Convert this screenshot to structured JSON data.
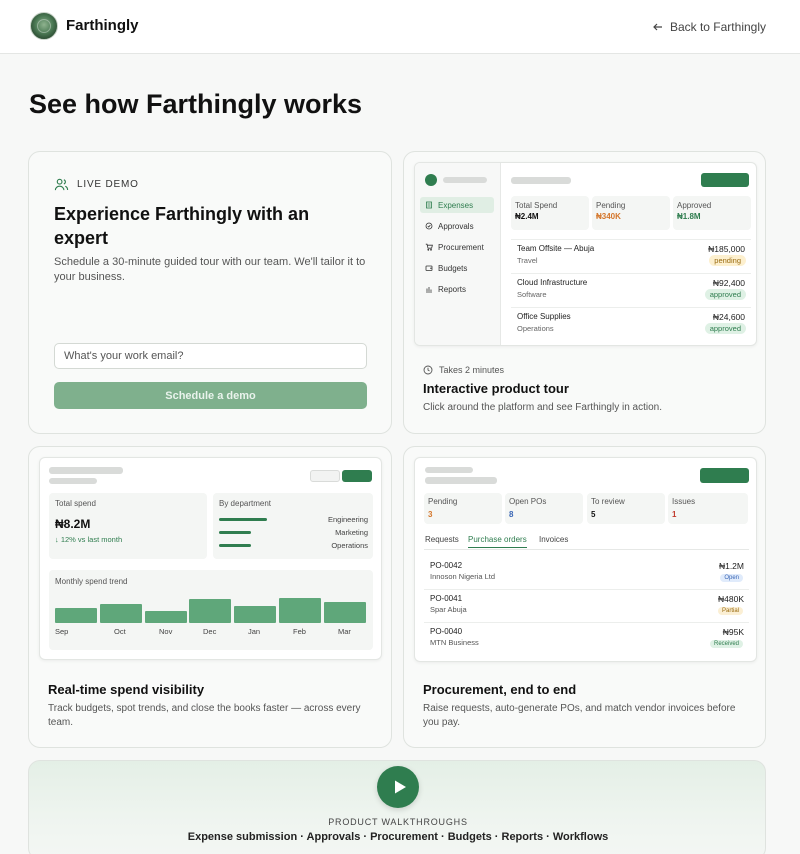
{
  "header": {
    "brand": "Farthingly",
    "back_link": "Back to Farthingly"
  },
  "page": {
    "title": "See how Farthingly works"
  },
  "demo_card": {
    "eyebrow": "LIVE DEMO",
    "title": "Experience Farthingly with an expert",
    "description": "Schedule a 30-minute guided tour with our team. We'll tailor it to your business.",
    "email_placeholder": "What's your work email?",
    "button_label": "Schedule a demo"
  },
  "tour_card": {
    "duration": "Takes 2 minutes",
    "title": "Interactive product tour",
    "description": "Click around the platform and see Farthingly in action.",
    "mock": {
      "nav": [
        "Expenses",
        "Approvals",
        "Procurement",
        "Budgets",
        "Reports"
      ],
      "stats": [
        {
          "label": "Total Spend",
          "value": "₦2.4M",
          "color": "#111111"
        },
        {
          "label": "Pending",
          "value": "₦340K",
          "color": "#d4762b"
        },
        {
          "label": "Approved",
          "value": "₦1.8M",
          "color": "#2f7d4f"
        }
      ],
      "transactions": [
        {
          "name": "Team Offsite — Abuja",
          "category": "Travel",
          "amount": "₦185,000",
          "status": "pending"
        },
        {
          "name": "Cloud Infrastructure",
          "category": "Software",
          "amount": "₦92,400",
          "status": "approved"
        },
        {
          "name": "Office Supplies",
          "category": "Operations",
          "amount": "₦24,600",
          "status": "approved"
        }
      ]
    }
  },
  "spend_card": {
    "title": "Real-time spend visibility",
    "description": "Track budgets, spot trends, and close the books faster — across every team.",
    "mock": {
      "total_label": "Total spend",
      "total_value": "₦8.2M",
      "delta": "↓ 12% vs last month",
      "dept_label": "By department",
      "departments": [
        {
          "name": "Engineering",
          "share": 0.67
        },
        {
          "name": "Marketing",
          "share": 0.45
        },
        {
          "name": "Operations",
          "share": 0.45
        }
      ],
      "trend_label": "Monthly spend trend",
      "trend": [
        {
          "month": "Sep",
          "value": 0.55
        },
        {
          "month": "Oct",
          "value": 0.7
        },
        {
          "month": "Nov",
          "value": 0.45
        },
        {
          "month": "Dec",
          "value": 0.88
        },
        {
          "month": "Jan",
          "value": 0.62
        },
        {
          "month": "Feb",
          "value": 0.92
        },
        {
          "month": "Mar",
          "value": 0.78
        }
      ]
    }
  },
  "proc_card": {
    "title": "Procurement, end to end",
    "description": "Raise requests, auto-generate POs, and match vendor invoices before you pay.",
    "mock": {
      "kpis": [
        {
          "label": "Pending",
          "value": "3",
          "color": "#d4762b"
        },
        {
          "label": "Open POs",
          "value": "8",
          "color": "#3a66b5"
        },
        {
          "label": "To review",
          "value": "5",
          "color": "#111111"
        },
        {
          "label": "Issues",
          "value": "1",
          "color": "#c0392b"
        }
      ],
      "tabs": [
        "Requests",
        "Purchase orders",
        "Invoices"
      ],
      "orders": [
        {
          "id": "PO-0042",
          "vendor": "Innoson Nigeria Ltd",
          "amount": "₦1.2M",
          "status": "Open"
        },
        {
          "id": "PO-0041",
          "vendor": "Spar Abuja",
          "amount": "₦480K",
          "status": "Partial"
        },
        {
          "id": "PO-0040",
          "vendor": "MTN Business",
          "amount": "₦95K",
          "status": "Received"
        }
      ]
    }
  },
  "walkthrough": {
    "eyebrow": "PRODUCT WALKTHROUGHS",
    "topics": "Expense submission · Approvals · Procurement · Budgets · Reports · Workflows"
  },
  "colors": {
    "brand_green": "#2f7d4f",
    "button_disabled": "#7fb08d"
  }
}
